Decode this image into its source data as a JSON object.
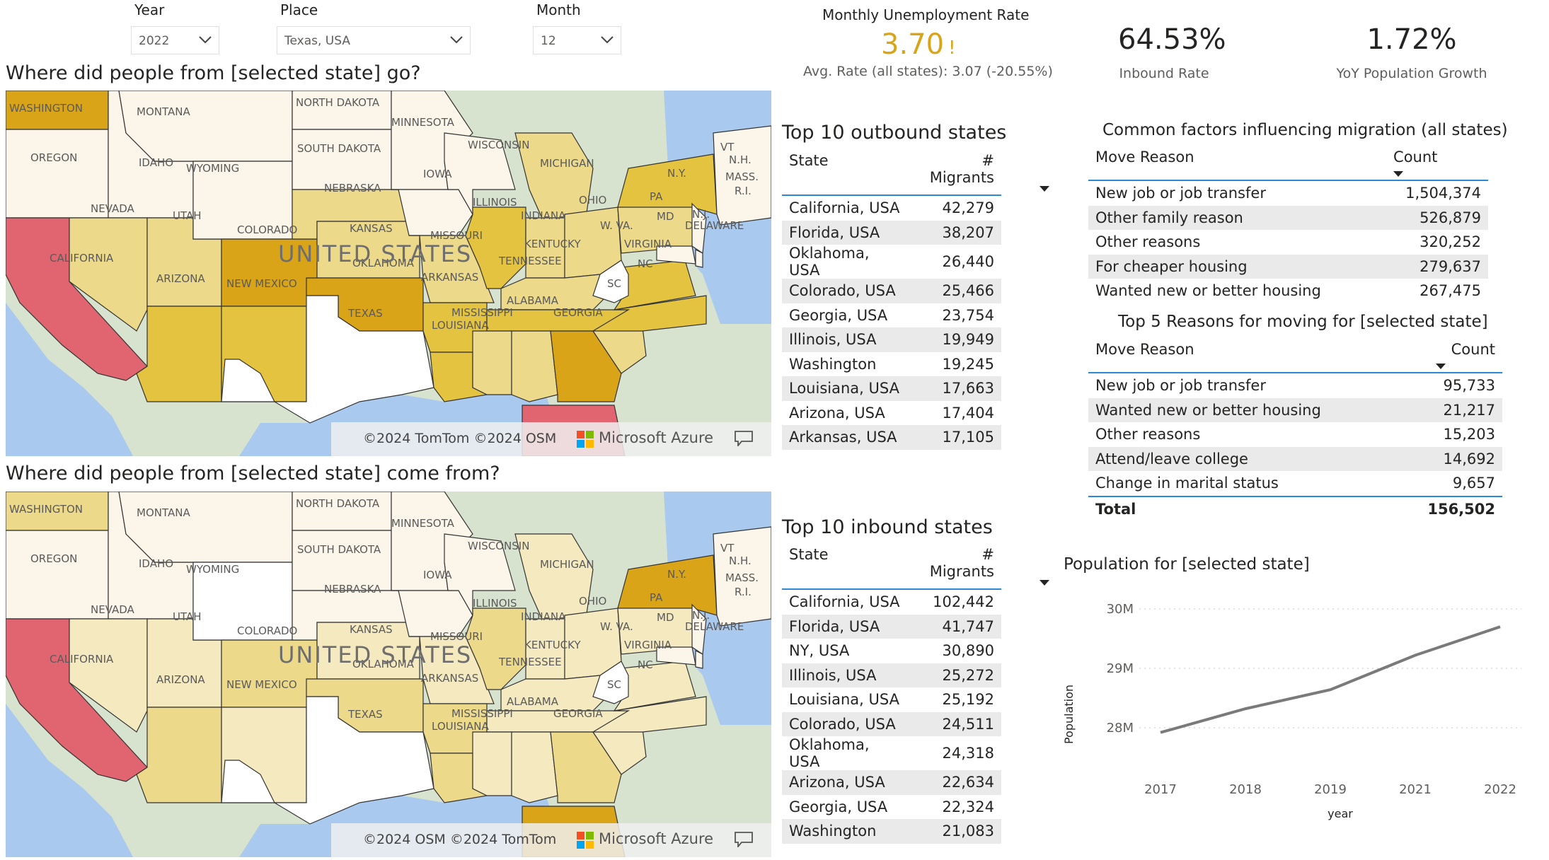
{
  "slicers": {
    "year": {
      "label": "Year",
      "value": "2022"
    },
    "place": {
      "label": "Place",
      "value": "Texas, USA"
    },
    "month": {
      "label": "Month",
      "value": "12"
    }
  },
  "maps": {
    "outbound_title": "Where did people from [selected state] go?",
    "inbound_title": "Where did people from [selected state] come from?",
    "country_label": "UNITED STATES",
    "outbound_copyright": "©2024 TomTom ©2024 OSM",
    "inbound_copyright": "©2024 OSM ©2024 TomTom",
    "brand": "Microsoft Azure",
    "state_labels": [
      "WASHINGTON",
      "MONTANA",
      "NORTH DAKOTA",
      "MINNESOTA",
      "OREGON",
      "IDAHO",
      "WYOMING",
      "SOUTH DAKOTA",
      "WISCONSIN",
      "MICHIGAN",
      "VT",
      "N.H.",
      "MASS.",
      "R.I.",
      "N.Y.",
      "IOWA",
      "NEBRASKA",
      "ILLINOIS",
      "INDIANA",
      "OHIO",
      "PA",
      "NEVADA",
      "UTAH",
      "COLORADO",
      "KANSAS",
      "MISSOURI",
      "N.J.",
      "MD",
      "W. VA.",
      "DELAWARE",
      "KENTUCKY",
      "VIRGINIA",
      "CALIFORNIA",
      "TENNESSEE",
      "NC",
      "ARIZONA",
      "NEW MEXICO",
      "OKLAHOMA",
      "ARKANSAS",
      "SC",
      "ALABAMA",
      "GEORGIA",
      "MISSISSIPPI",
      "TEXAS",
      "LOUISIANA"
    ],
    "colors": {
      "max": "#e06570",
      "high": "#d9a418",
      "mid": "#e3c340",
      "low": "#ecd98a",
      "lowest": "#f4e9bf",
      "none": "#fbf6e9",
      "selected": "#ffffff",
      "water": "#a9c9ee"
    }
  },
  "outbound_table": {
    "title": "Top 10 outbound states",
    "col_state": "State",
    "col_migrants": "# Migrants",
    "rows": [
      {
        "state": "California, USA",
        "migrants": "42,279"
      },
      {
        "state": "Florida, USA",
        "migrants": "38,207"
      },
      {
        "state": "Oklahoma, USA",
        "migrants": "26,440"
      },
      {
        "state": "Colorado, USA",
        "migrants": "25,466"
      },
      {
        "state": "Georgia, USA",
        "migrants": "23,754"
      },
      {
        "state": "Illinois, USA",
        "migrants": "19,949"
      },
      {
        "state": "Washington",
        "migrants": "19,245"
      },
      {
        "state": "Louisiana, USA",
        "migrants": "17,663"
      },
      {
        "state": "Arizona, USA",
        "migrants": "17,404"
      },
      {
        "state": "Arkansas, USA",
        "migrants": "17,105"
      }
    ]
  },
  "inbound_table": {
    "title": "Top 10 inbound states",
    "col_state": "State",
    "col_migrants": "# Migrants",
    "rows": [
      {
        "state": "California, USA",
        "migrants": "102,442"
      },
      {
        "state": "Florida, USA",
        "migrants": "41,747"
      },
      {
        "state": "NY, USA",
        "migrants": "30,890"
      },
      {
        "state": "Illinois, USA",
        "migrants": "25,272"
      },
      {
        "state": "Louisiana, USA",
        "migrants": "25,192"
      },
      {
        "state": "Colorado, USA",
        "migrants": "24,511"
      },
      {
        "state": "Oklahoma, USA",
        "migrants": "24,318"
      },
      {
        "state": "Arizona, USA",
        "migrants": "22,634"
      },
      {
        "state": "Georgia, USA",
        "migrants": "22,324"
      },
      {
        "state": "Washington",
        "migrants": "21,083"
      }
    ]
  },
  "unemployment": {
    "title": "Monthly Unemployment Rate",
    "value": "3.70",
    "alert": "!",
    "subtitle": "Avg. Rate (all states): 3.07 (-20.55%)",
    "color": "#d9a418"
  },
  "kpis": {
    "inbound_rate": {
      "value": "64.53%",
      "label": "Inbound Rate"
    },
    "yoy_growth": {
      "value": "1.72%",
      "label": "YoY Population Growth"
    }
  },
  "factors_table": {
    "title": "Common factors influencing migration (all states)",
    "col_reason": "Move Reason",
    "col_count": "Count",
    "rows": [
      {
        "reason": "New job or job transfer",
        "count": "1,504,374"
      },
      {
        "reason": "Other family reason",
        "count": "526,879"
      },
      {
        "reason": "Other reasons",
        "count": "320,252"
      },
      {
        "reason": "For cheaper housing",
        "count": "279,637"
      },
      {
        "reason": "Wanted new or better housing",
        "count": "267,475"
      }
    ]
  },
  "reasons_table": {
    "title": "Top 5 Reasons for moving for [selected state]",
    "col_reason": "Move Reason",
    "col_count": "Count",
    "rows": [
      {
        "reason": "New job or job transfer",
        "count": "95,733"
      },
      {
        "reason": "Wanted new or better housing",
        "count": "21,217"
      },
      {
        "reason": "Other reasons",
        "count": "15,203"
      },
      {
        "reason": "Attend/leave college",
        "count": "14,692"
      },
      {
        "reason": "Change in marital status",
        "count": "9,657"
      }
    ],
    "total_label": "Total",
    "total_value": "156,502"
  },
  "chart_data": {
    "type": "line",
    "title": "Population for [selected state]",
    "xlabel": "year",
    "ylabel": "Population",
    "categories": [
      "2017",
      "2018",
      "2019",
      "2021",
      "2022"
    ],
    "values": [
      27.92,
      28.32,
      28.64,
      29.22,
      29.7
    ],
    "yticks": [
      "28M",
      "29M",
      "30M"
    ],
    "ytick_values": [
      28,
      29,
      30
    ],
    "ylim": [
      27.75,
      30.25
    ],
    "grid": true,
    "line_color": "#7a7a7a"
  }
}
